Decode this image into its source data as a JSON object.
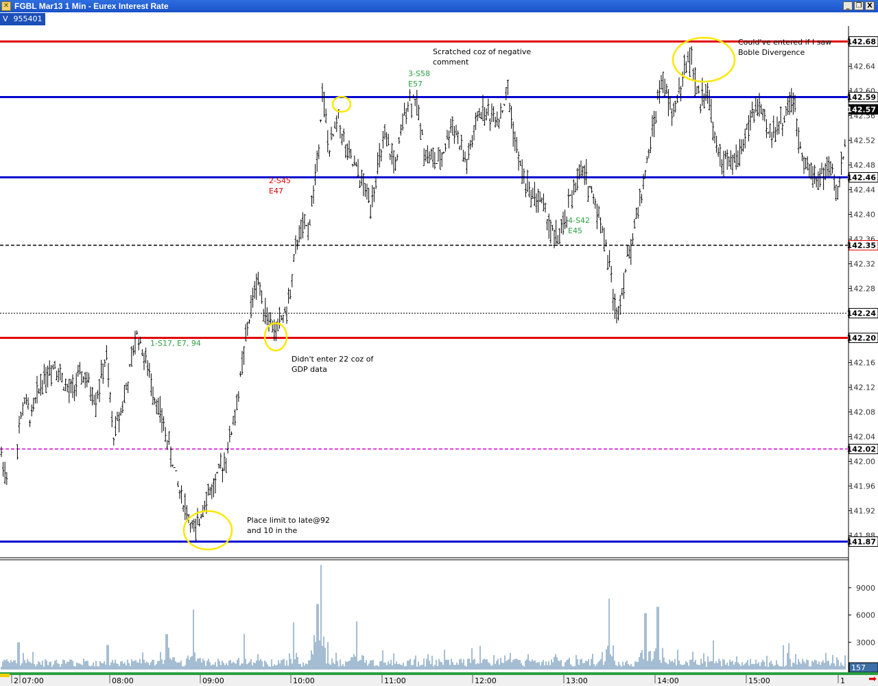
{
  "window": {
    "title": "FGBL Mar13 1 Min - Eurex Interest Rate",
    "indicator_label": "V",
    "indicator_value": "955401",
    "buttons": [
      "_",
      "❐",
      "X"
    ]
  },
  "colors": {
    "titlebar": "#1f5bd0",
    "price_bars": "#000000",
    "resistance_red": "#e00000",
    "support_blue": "#0000d0",
    "pivot_magenta": "#d000d0",
    "volume": "#4a7ba6",
    "highlight_circle": "#ffe600"
  },
  "annotations": [
    {
      "id": "trade1",
      "text": "1-S17, E7, 94",
      "color": "green"
    },
    {
      "id": "trade2",
      "text": "2-S45\nE47",
      "color": "red"
    },
    {
      "id": "trade3",
      "text": "3-S58\nE57",
      "color": "green"
    },
    {
      "id": "trade4",
      "text": "4-S42\nE45",
      "color": "green"
    },
    {
      "id": "note_scratched",
      "text": "Scratched coz of negative\ncomment",
      "color": "black"
    },
    {
      "id": "note_bobl",
      "text": "Could've entered if I saw\nBoble Divergence",
      "color": "black"
    },
    {
      "id": "note_gdp",
      "text": "Didn't enter 22 coz of\nGDP data",
      "color": "black"
    },
    {
      "id": "note_limit",
      "text": "Place limit to late@92\nand 10 in the",
      "color": "black"
    }
  ],
  "chart_data": {
    "type": "ohlc",
    "title": "FGBL Mar13 1 Min - Eurex Interest Rate",
    "price_axis": {
      "ylim": [
        141.845,
        142.705
      ],
      "ticks": [
        "142.64",
        "142.60",
        "142.56",
        "142.52",
        "142.48",
        "142.44",
        "142.40",
        "142.36",
        "142.32",
        "142.28",
        "142.24",
        "142.20",
        "142.16",
        "142.12",
        "142.08",
        "142.04",
        "142.00",
        "141.96",
        "141.92",
        "141.88"
      ],
      "boxed_labels": [
        {
          "label": "142.68",
          "value": 142.68,
          "style": "normal"
        },
        {
          "label": "142.59",
          "value": 142.59,
          "style": "normal"
        },
        {
          "label": "142.57",
          "value": 142.57,
          "style": "current"
        },
        {
          "label": "142.46",
          "value": 142.46,
          "style": "normal"
        },
        {
          "label": "142.35",
          "value": 142.35,
          "style": "red-border"
        },
        {
          "label": "142.24",
          "value": 142.24,
          "style": "normal"
        },
        {
          "label": "142.20",
          "value": 142.2,
          "style": "normal"
        },
        {
          "label": "142.02",
          "value": 142.02,
          "style": "normal"
        },
        {
          "label": "141.87",
          "value": 141.87,
          "style": "normal"
        }
      ]
    },
    "horizontal_lines": [
      {
        "value": 142.68,
        "color": "red",
        "style": "solid"
      },
      {
        "value": 142.59,
        "color": "blue",
        "style": "solid"
      },
      {
        "value": 142.46,
        "color": "blue",
        "style": "solid"
      },
      {
        "value": 142.35,
        "color": "black",
        "style": "dashed"
      },
      {
        "value": 142.24,
        "color": "black",
        "style": "dotted"
      },
      {
        "value": 142.2,
        "color": "red",
        "style": "solid"
      },
      {
        "value": 142.02,
        "color": "magenta",
        "style": "dashed"
      },
      {
        "value": 141.87,
        "color": "blue",
        "style": "solid"
      }
    ],
    "time_axis": {
      "ticks": [
        "2",
        "07:00",
        "08:00",
        "09:00",
        "10:00",
        "11:00",
        "12:00",
        "13:00",
        "14:00",
        "15:00",
        "1"
      ]
    },
    "price_path": [
      [
        0,
        142.02
      ],
      [
        10,
        141.97
      ],
      [
        25,
        142.03
      ],
      [
        35,
        142.1
      ],
      [
        45,
        142.07
      ],
      [
        60,
        142.13
      ],
      [
        80,
        142.16
      ],
      [
        100,
        142.11
      ],
      [
        120,
        142.14
      ],
      [
        140,
        142.1
      ],
      [
        155,
        142.17
      ],
      [
        165,
        142.04
      ],
      [
        175,
        142.08
      ],
      [
        185,
        142.12
      ],
      [
        200,
        142.21
      ],
      [
        215,
        142.15
      ],
      [
        230,
        142.09
      ],
      [
        245,
        142.03
      ],
      [
        260,
        141.96
      ],
      [
        275,
        141.91
      ],
      [
        285,
        141.88
      ],
      [
        298,
        141.94
      ],
      [
        312,
        141.96
      ],
      [
        330,
        142.01
      ],
      [
        345,
        142.09
      ],
      [
        360,
        142.21
      ],
      [
        375,
        142.3
      ],
      [
        385,
        142.25
      ],
      [
        400,
        142.21
      ],
      [
        420,
        142.25
      ],
      [
        435,
        142.37
      ],
      [
        450,
        142.38
      ],
      [
        462,
        142.48
      ],
      [
        470,
        142.6
      ],
      [
        480,
        142.5
      ],
      [
        493,
        142.56
      ],
      [
        505,
        142.5
      ],
      [
        520,
        142.47
      ],
      [
        540,
        142.42
      ],
      [
        560,
        142.52
      ],
      [
        578,
        142.48
      ],
      [
        592,
        142.58
      ],
      [
        605,
        142.59
      ],
      [
        620,
        142.5
      ],
      [
        640,
        142.48
      ],
      [
        660,
        142.55
      ],
      [
        680,
        142.48
      ],
      [
        700,
        142.57
      ],
      [
        715,
        142.56
      ],
      [
        730,
        142.56
      ],
      [
        740,
        142.6
      ],
      [
        755,
        142.49
      ],
      [
        770,
        142.44
      ],
      [
        790,
        142.42
      ],
      [
        808,
        142.36
      ],
      [
        820,
        142.37
      ],
      [
        835,
        142.44
      ],
      [
        850,
        142.47
      ],
      [
        865,
        142.43
      ],
      [
        878,
        142.38
      ],
      [
        890,
        142.31
      ],
      [
        898,
        142.23
      ],
      [
        910,
        142.3
      ],
      [
        925,
        142.38
      ],
      [
        940,
        142.46
      ],
      [
        955,
        142.56
      ],
      [
        965,
        142.62
      ],
      [
        980,
        142.56
      ],
      [
        995,
        142.62
      ],
      [
        1005,
        142.66
      ],
      [
        1020,
        142.58
      ],
      [
        1030,
        142.61
      ],
      [
        1045,
        142.5
      ],
      [
        1060,
        142.48
      ],
      [
        1075,
        142.49
      ],
      [
        1090,
        142.54
      ],
      [
        1105,
        142.58
      ],
      [
        1120,
        142.53
      ],
      [
        1140,
        142.55
      ],
      [
        1155,
        142.59
      ],
      [
        1165,
        142.52
      ],
      [
        1180,
        142.47
      ],
      [
        1195,
        142.46
      ],
      [
        1210,
        142.48
      ],
      [
        1220,
        142.43
      ],
      [
        1232,
        142.51
      ]
    ],
    "volume_axis": {
      "ylim": [
        0,
        12000
      ],
      "ticks": [
        "9000",
        "6000",
        "3000"
      ],
      "last_label": "157"
    },
    "volume_spikes": [
      [
        27,
        3000
      ],
      [
        157,
        2700
      ],
      [
        243,
        3900
      ],
      [
        282,
        6600
      ],
      [
        356,
        3900
      ],
      [
        428,
        5200
      ],
      [
        463,
        7200
      ],
      [
        468,
        11500
      ],
      [
        520,
        5300
      ],
      [
        700,
        2600
      ],
      [
        888,
        7800
      ],
      [
        941,
        6200
      ],
      [
        959,
        6900
      ],
      [
        1040,
        3200
      ],
      [
        1150,
        2900
      ]
    ]
  }
}
